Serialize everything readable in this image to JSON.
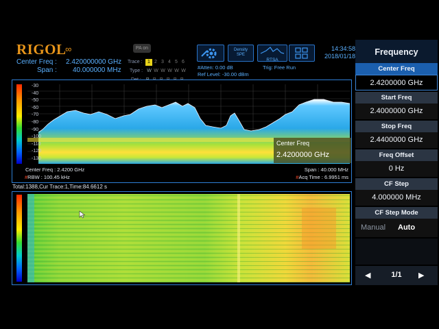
{
  "header": {
    "brand": "RIGOL",
    "center_freq_label": "Center Freq :",
    "center_freq_value": "2.420000000 GHz",
    "span_label": "Span :",
    "span_value": "40.000000 MHz",
    "pa_badge": "PA on",
    "trace_label": "Trace :",
    "trace_numbers": [
      "1",
      "2",
      "3",
      "4",
      "5",
      "6"
    ],
    "type_label": "Type :",
    "type_values": [
      "W",
      "W",
      "W",
      "W",
      "W",
      "W"
    ],
    "det_label": "Det :",
    "det_values": [
      "P",
      "P",
      "P",
      "P",
      "P",
      "P"
    ],
    "atten": "#Atten: 0.00 dB",
    "ref_level": "Ref Level: -30.00 dBm",
    "trig": "Trig: Free Run",
    "density_btn": "Density SPE",
    "rtsa_btn": "RTSA",
    "time": "14:34:58",
    "date": "2018/01/18"
  },
  "spectrum": {
    "y_ticks": [
      "-30",
      "-40",
      "-50",
      "-60",
      "-70",
      "-80",
      "-90",
      "-100",
      "-110",
      "-120",
      "-130"
    ],
    "popup_label": "Center Freq",
    "popup_value": "2.4200000 GHz",
    "foot_center": "Center Freq : 2.4200 GHz",
    "foot_rbw": "RBW : 100.45 kHz",
    "foot_span": "Span : 40.000 MHz",
    "foot_acq": "Acq Time : 6.9951 ms"
  },
  "waterfall": {
    "info": "Total:1388,Cur Trace:1,Time:84.6612 s"
  },
  "menu": {
    "title": "Frequency",
    "items": [
      {
        "label": "Center Freq",
        "value": "2.4200000 GHz"
      },
      {
        "label": "Start Freq",
        "value": "2.4000000 GHz"
      },
      {
        "label": "Stop Freq",
        "value": "2.4400000 GHz"
      },
      {
        "label": "Freq Offset",
        "value": "0 Hz"
      },
      {
        "label": "CF Step",
        "value": "4.000000 MHz"
      },
      {
        "label": "CF Step Mode"
      }
    ],
    "mode_manual": "Manual",
    "mode_auto": "Auto",
    "page": "1/1"
  },
  "colors": {
    "accent": "#2f7fd6",
    "brand": "#e8951a",
    "selected": "#1b5fae"
  }
}
